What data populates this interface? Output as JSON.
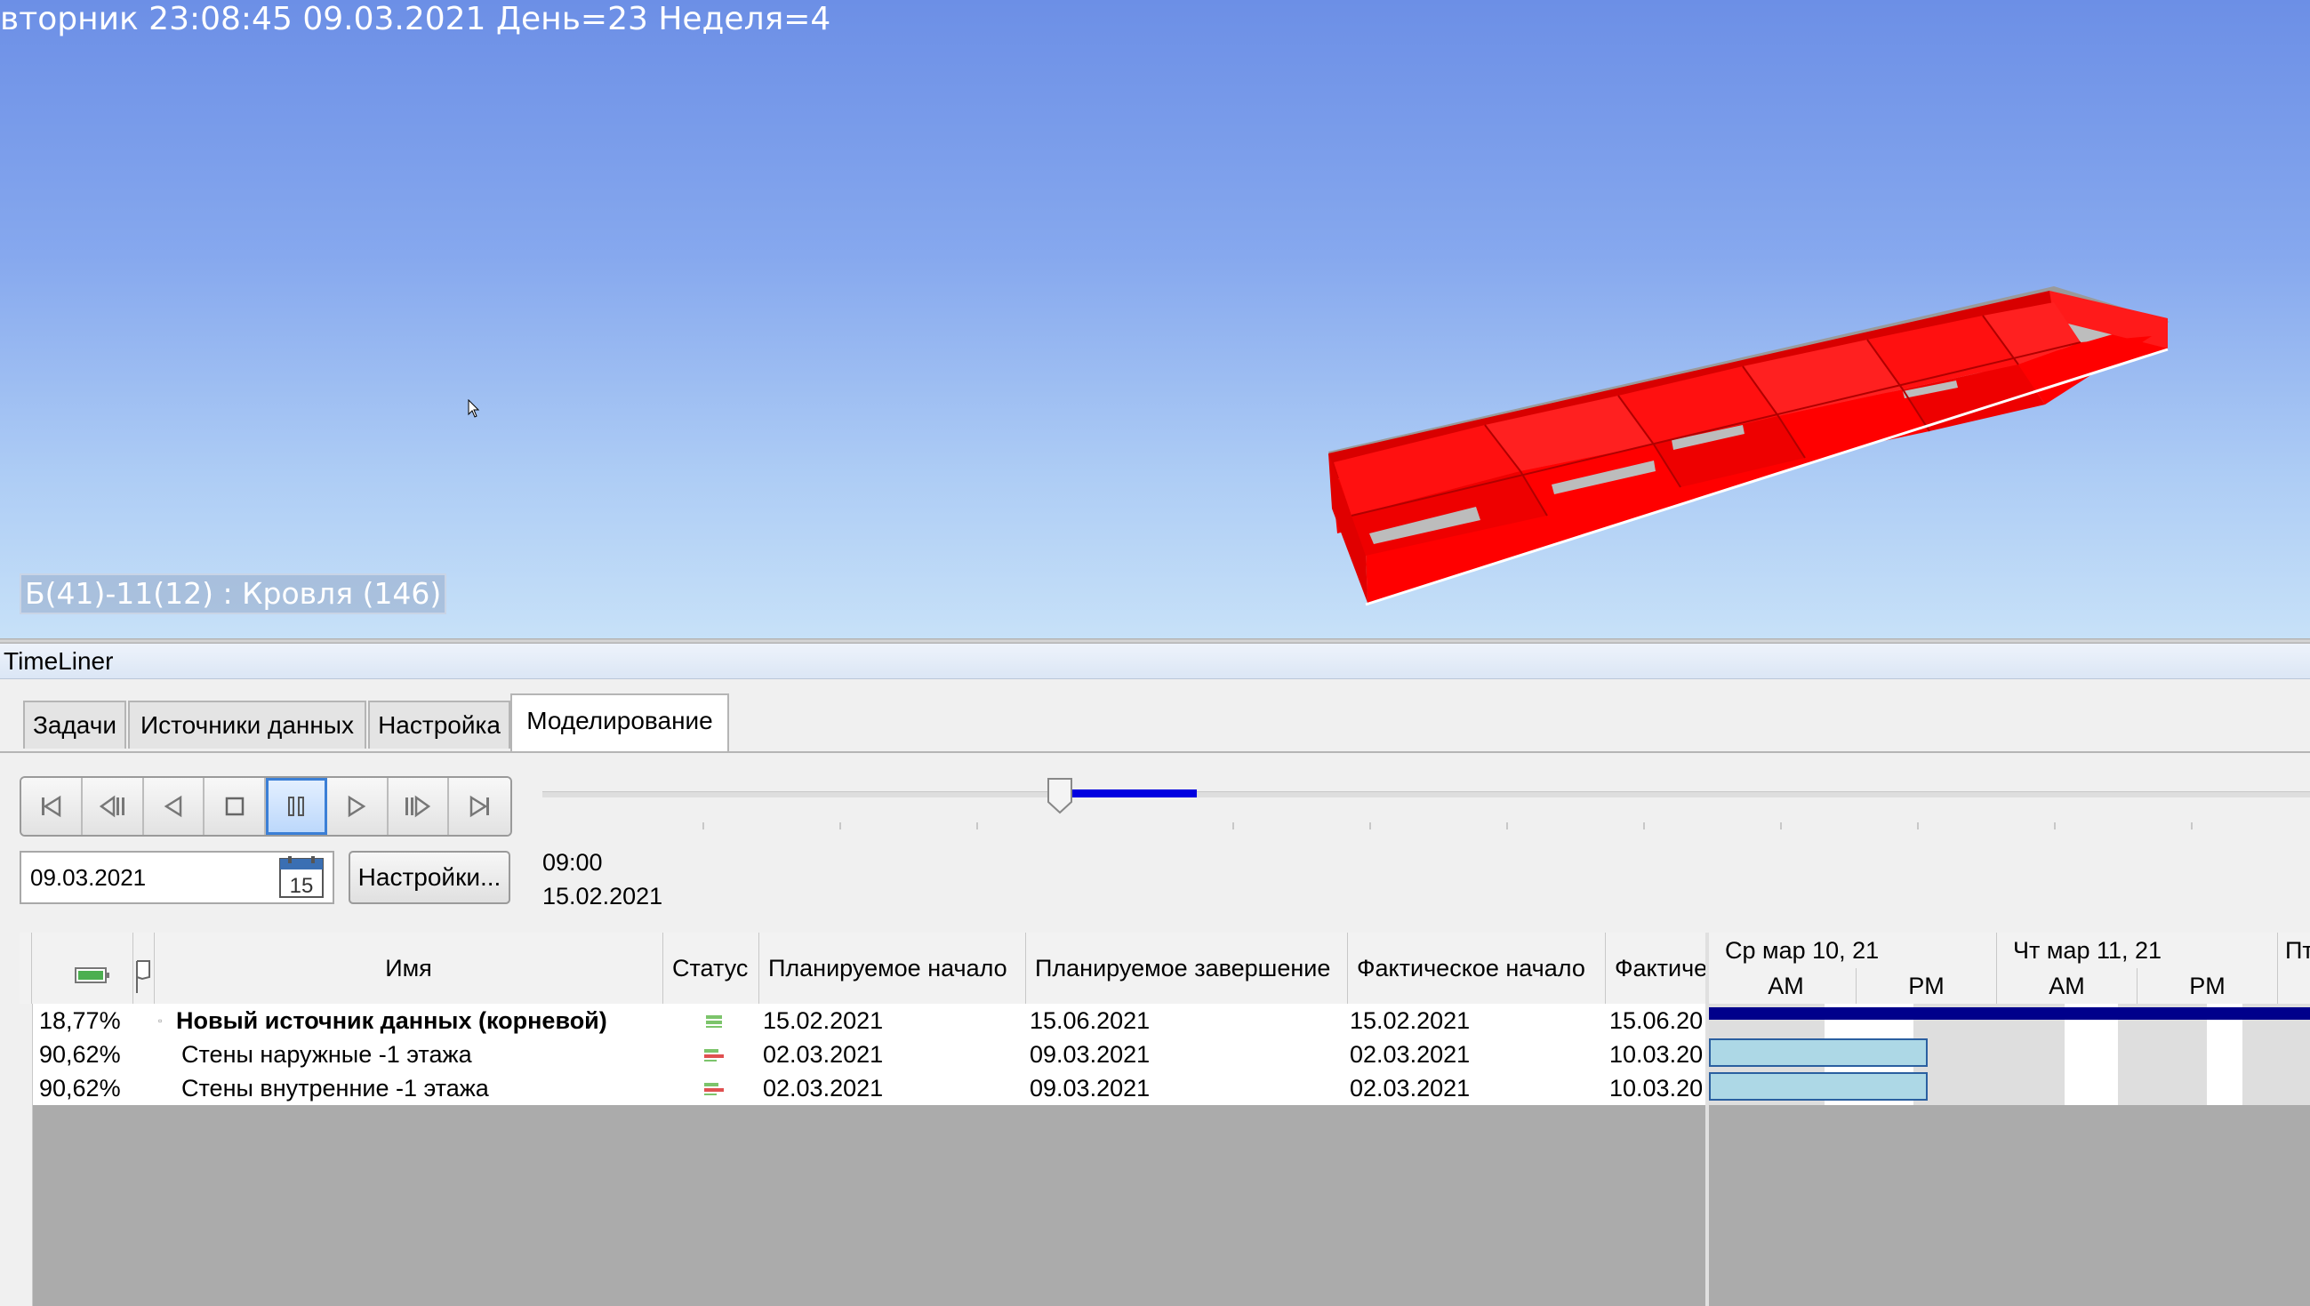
{
  "viewport": {
    "status_line": "вторник 23:08:45 09.03.2021 День=23 Неделя=4",
    "selection_label": "Б(41)-11(12) : Кровля (146)",
    "model_color": "#ff0000"
  },
  "panel": {
    "title": "TimeLiner"
  },
  "tabs": [
    {
      "label": "Задачи",
      "active": false
    },
    {
      "label": "Источники данных",
      "active": false
    },
    {
      "label": "Настройка",
      "active": false
    },
    {
      "label": "Моделирование",
      "active": true
    }
  ],
  "transport": {
    "buttons": [
      "rewind-to-start",
      "step-back",
      "play-reverse",
      "stop",
      "pause",
      "play",
      "step-forward",
      "forward-to-end"
    ],
    "active": "pause"
  },
  "simulation": {
    "date_value": "09.03.2021",
    "calendar_day": "15",
    "settings_label": "Настройки...",
    "current_time": "09:00",
    "current_date": "15.02.2021",
    "slider_position": 0.24,
    "playback_accent": "#0000e0"
  },
  "grid": {
    "columns": [
      "",
      "",
      "Имя",
      "Статус",
      "Планируемое начало",
      "Планируемое завершение",
      "Фактическое начало",
      "Фактиче"
    ],
    "rows": [
      {
        "progress": "18,77%",
        "name": "Новый источник данных (корневой)",
        "bold": true,
        "plan_start": "15.02.2021",
        "plan_end": "15.06.2021",
        "actual_start": "15.02.2021",
        "actual_end": "15.06.20"
      },
      {
        "progress": "90,62%",
        "name": "Стены наружные -1 этажа",
        "bold": false,
        "plan_start": "02.03.2021",
        "plan_end": "09.03.2021",
        "actual_start": "02.03.2021",
        "actual_end": "10.03.20"
      },
      {
        "progress": "90,62%",
        "name": "Стены внутренние -1 этажа",
        "bold": false,
        "plan_start": "02.03.2021",
        "plan_end": "09.03.2021",
        "actual_start": "02.03.2021",
        "actual_end": "10.03.20"
      }
    ]
  },
  "gantt": {
    "days": [
      "Ср мар 10, 21",
      "Чт мар 11, 21",
      "Пт"
    ],
    "halves": [
      "AM",
      "PM",
      "AM",
      "PM"
    ],
    "root_bar_color": "#00008b",
    "task_bar_color": "#add8e6"
  }
}
